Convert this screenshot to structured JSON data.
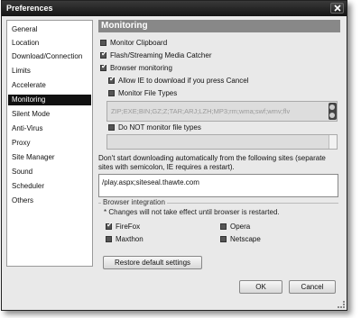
{
  "window": {
    "title": "Preferences"
  },
  "sidebar": {
    "items": [
      {
        "label": "General",
        "selected": false
      },
      {
        "label": "Location",
        "selected": false
      },
      {
        "label": "Download/Connection",
        "selected": false
      },
      {
        "label": "Limits",
        "selected": false
      },
      {
        "label": "Accelerate",
        "selected": false
      },
      {
        "label": "Monitoring",
        "selected": true
      },
      {
        "label": "Silent Mode",
        "selected": false
      },
      {
        "label": "Anti-Virus",
        "selected": false
      },
      {
        "label": "Proxy",
        "selected": false
      },
      {
        "label": "Site Manager",
        "selected": false
      },
      {
        "label": "Sound",
        "selected": false
      },
      {
        "label": "Scheduler",
        "selected": false
      },
      {
        "label": "Others",
        "selected": false
      }
    ]
  },
  "monitoring": {
    "section_title": "Monitoring",
    "monitor_clipboard": {
      "label": "Monitor Clipboard",
      "checked": false
    },
    "flash_streaming": {
      "label": "Flash/Streaming Media Catcher",
      "checked": true
    },
    "browser_monitoring": {
      "label": "Browser monitoring",
      "checked": true
    },
    "allow_ie": {
      "label": "Allow IE to download if you press Cancel",
      "checked": true
    },
    "monitor_file_types": {
      "label": "Monitor File Types",
      "checked": false
    },
    "file_types_value": "ZIP;EXE;BIN;GZ;Z;TAR;ARJ;LZH;MP3;rm;wma;swf;wmv;flv",
    "do_not_monitor": {
      "label": "Do NOT monitor file types",
      "checked": false
    },
    "exclude_types_value": "",
    "sites_note": "Don't start downloading automatically from the following sites (separate sites with semicolon, IE requires a restart).",
    "sites_value": "/play.aspx;siteseal.thawte.com"
  },
  "browser_integration": {
    "legend": "Browser integration",
    "note": "* Changes will not take effect until browser is restarted.",
    "browsers": [
      {
        "label": "FireFox",
        "checked": true
      },
      {
        "label": "Opera",
        "checked": false
      },
      {
        "label": "Maxthon",
        "checked": false
      },
      {
        "label": "Netscape",
        "checked": false
      }
    ]
  },
  "buttons": {
    "restore": "Restore default settings",
    "ok": "OK",
    "cancel": "Cancel"
  },
  "icons": {
    "close": "close-icon",
    "check": "checkmark-icon",
    "resize": "resize-grip-icon"
  }
}
